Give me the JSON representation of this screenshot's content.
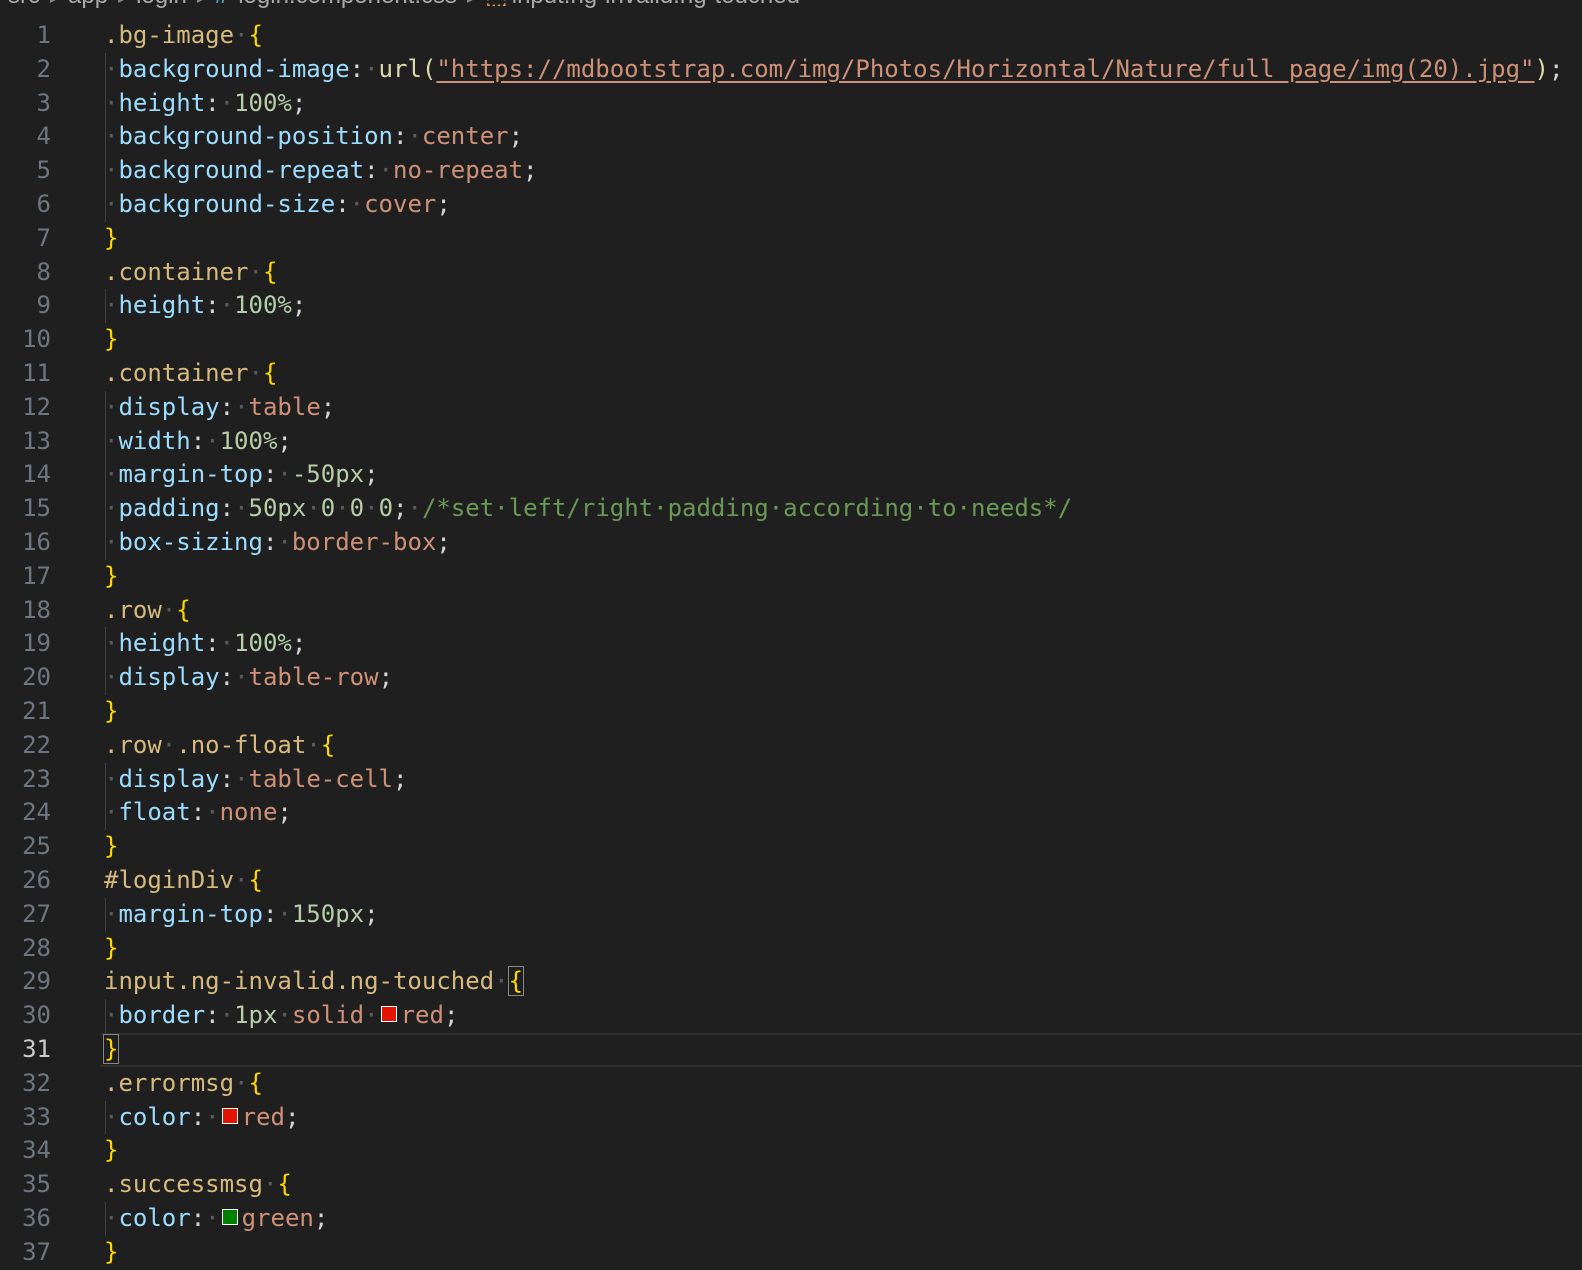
{
  "breadcrumb": {
    "items": [
      "src",
      "app",
      "login",
      "login.component.css",
      "input.ng-invalid.ng-touched"
    ],
    "css_icon": "#",
    "symbol_icon": "⬚"
  },
  "editor": {
    "active_line": 31,
    "colors": {
      "red": "#e51400",
      "green": "#008000"
    },
    "lines": [
      {
        "n": "1",
        "t": [
          {
            "c": "sel",
            "v": ".bg-image"
          },
          {
            "c": "ws",
            "v": "·"
          },
          {
            "c": "brace",
            "v": "{"
          }
        ]
      },
      {
        "n": "2",
        "g": true,
        "t": [
          {
            "c": "ws",
            "v": "·"
          },
          {
            "c": "prop",
            "v": "background-image"
          },
          {
            "c": "punc",
            "v": ":"
          },
          {
            "c": "ws",
            "v": "·"
          },
          {
            "c": "fn",
            "v": "url("
          },
          {
            "c": "str",
            "v": "\"https://mdbootstrap.com/img/Photos/Horizontal/Nature/full page/img(20).jpg\""
          },
          {
            "c": "fn",
            "v": ")"
          },
          {
            "c": "punc",
            "v": ";"
          }
        ]
      },
      {
        "n": "3",
        "g": true,
        "t": [
          {
            "c": "ws",
            "v": "·"
          },
          {
            "c": "prop",
            "v": "height"
          },
          {
            "c": "punc",
            "v": ":"
          },
          {
            "c": "ws",
            "v": "·"
          },
          {
            "c": "num",
            "v": "100%"
          },
          {
            "c": "punc",
            "v": ";"
          }
        ]
      },
      {
        "n": "4",
        "g": true,
        "t": [
          {
            "c": "ws",
            "v": "·"
          },
          {
            "c": "prop",
            "v": "background-position"
          },
          {
            "c": "punc",
            "v": ":"
          },
          {
            "c": "ws",
            "v": "·"
          },
          {
            "c": "val",
            "v": "center"
          },
          {
            "c": "punc",
            "v": ";"
          }
        ]
      },
      {
        "n": "5",
        "g": true,
        "t": [
          {
            "c": "ws",
            "v": "·"
          },
          {
            "c": "prop",
            "v": "background-repeat"
          },
          {
            "c": "punc",
            "v": ":"
          },
          {
            "c": "ws",
            "v": "·"
          },
          {
            "c": "val",
            "v": "no-repeat"
          },
          {
            "c": "punc",
            "v": ";"
          }
        ]
      },
      {
        "n": "6",
        "g": true,
        "t": [
          {
            "c": "ws",
            "v": "·"
          },
          {
            "c": "prop",
            "v": "background-size"
          },
          {
            "c": "punc",
            "v": ":"
          },
          {
            "c": "ws",
            "v": "·"
          },
          {
            "c": "val",
            "v": "cover"
          },
          {
            "c": "punc",
            "v": ";"
          }
        ]
      },
      {
        "n": "7",
        "t": [
          {
            "c": "brace",
            "v": "}"
          }
        ]
      },
      {
        "n": "8",
        "t": [
          {
            "c": "sel",
            "v": ".container"
          },
          {
            "c": "ws",
            "v": "·"
          },
          {
            "c": "brace",
            "v": "{"
          }
        ]
      },
      {
        "n": "9",
        "g": true,
        "t": [
          {
            "c": "ws",
            "v": "·"
          },
          {
            "c": "prop",
            "v": "height"
          },
          {
            "c": "punc",
            "v": ":"
          },
          {
            "c": "ws",
            "v": "·"
          },
          {
            "c": "num",
            "v": "100%"
          },
          {
            "c": "punc",
            "v": ";"
          }
        ]
      },
      {
        "n": "10",
        "t": [
          {
            "c": "brace",
            "v": "}"
          }
        ]
      },
      {
        "n": "11",
        "t": [
          {
            "c": "sel",
            "v": ".container"
          },
          {
            "c": "ws",
            "v": "·"
          },
          {
            "c": "brace",
            "v": "{"
          }
        ]
      },
      {
        "n": "12",
        "g": true,
        "t": [
          {
            "c": "ws",
            "v": "·"
          },
          {
            "c": "prop",
            "v": "display"
          },
          {
            "c": "punc",
            "v": ":"
          },
          {
            "c": "ws",
            "v": "·"
          },
          {
            "c": "val",
            "v": "table"
          },
          {
            "c": "punc",
            "v": ";"
          }
        ]
      },
      {
        "n": "13",
        "g": true,
        "t": [
          {
            "c": "ws",
            "v": "·"
          },
          {
            "c": "prop",
            "v": "width"
          },
          {
            "c": "punc",
            "v": ":"
          },
          {
            "c": "ws",
            "v": "·"
          },
          {
            "c": "num",
            "v": "100%"
          },
          {
            "c": "punc",
            "v": ";"
          }
        ]
      },
      {
        "n": "14",
        "g": true,
        "t": [
          {
            "c": "ws",
            "v": "·"
          },
          {
            "c": "prop",
            "v": "margin-top"
          },
          {
            "c": "punc",
            "v": ":"
          },
          {
            "c": "ws",
            "v": "·"
          },
          {
            "c": "num",
            "v": "-50px"
          },
          {
            "c": "punc",
            "v": ";"
          }
        ]
      },
      {
        "n": "15",
        "g": true,
        "t": [
          {
            "c": "ws",
            "v": "·"
          },
          {
            "c": "prop",
            "v": "padding"
          },
          {
            "c": "punc",
            "v": ":"
          },
          {
            "c": "ws",
            "v": "·"
          },
          {
            "c": "num",
            "v": "50px"
          },
          {
            "c": "ws",
            "v": "·"
          },
          {
            "c": "num",
            "v": "0"
          },
          {
            "c": "ws",
            "v": "·"
          },
          {
            "c": "num",
            "v": "0"
          },
          {
            "c": "ws",
            "v": "·"
          },
          {
            "c": "num",
            "v": "0"
          },
          {
            "c": "punc",
            "v": ";"
          },
          {
            "c": "ws",
            "v": "·"
          },
          {
            "c": "cmt",
            "v": "/*set·left/right·padding·according·to·needs*/"
          }
        ]
      },
      {
        "n": "16",
        "g": true,
        "t": [
          {
            "c": "ws",
            "v": "·"
          },
          {
            "c": "prop",
            "v": "box-sizing"
          },
          {
            "c": "punc",
            "v": ":"
          },
          {
            "c": "ws",
            "v": "·"
          },
          {
            "c": "val",
            "v": "border-box"
          },
          {
            "c": "punc",
            "v": ";"
          }
        ]
      },
      {
        "n": "17",
        "t": [
          {
            "c": "brace",
            "v": "}"
          }
        ]
      },
      {
        "n": "18",
        "t": [
          {
            "c": "sel",
            "v": ".row"
          },
          {
            "c": "ws",
            "v": "·"
          },
          {
            "c": "brace",
            "v": "{"
          }
        ]
      },
      {
        "n": "19",
        "g": true,
        "t": [
          {
            "c": "ws",
            "v": "·"
          },
          {
            "c": "prop",
            "v": "height"
          },
          {
            "c": "punc",
            "v": ":"
          },
          {
            "c": "ws",
            "v": "·"
          },
          {
            "c": "num",
            "v": "100%"
          },
          {
            "c": "punc",
            "v": ";"
          }
        ]
      },
      {
        "n": "20",
        "g": true,
        "t": [
          {
            "c": "ws",
            "v": "·"
          },
          {
            "c": "prop",
            "v": "display"
          },
          {
            "c": "punc",
            "v": ":"
          },
          {
            "c": "ws",
            "v": "·"
          },
          {
            "c": "val",
            "v": "table-row"
          },
          {
            "c": "punc",
            "v": ";"
          }
        ]
      },
      {
        "n": "21",
        "t": [
          {
            "c": "brace",
            "v": "}"
          }
        ]
      },
      {
        "n": "22",
        "t": [
          {
            "c": "sel",
            "v": ".row"
          },
          {
            "c": "ws",
            "v": "·"
          },
          {
            "c": "sel",
            "v": ".no-float"
          },
          {
            "c": "ws",
            "v": "·"
          },
          {
            "c": "brace",
            "v": "{"
          }
        ]
      },
      {
        "n": "23",
        "g": true,
        "t": [
          {
            "c": "ws",
            "v": "·"
          },
          {
            "c": "prop",
            "v": "display"
          },
          {
            "c": "punc",
            "v": ":"
          },
          {
            "c": "ws",
            "v": "·"
          },
          {
            "c": "val",
            "v": "table-cell"
          },
          {
            "c": "punc",
            "v": ";"
          }
        ]
      },
      {
        "n": "24",
        "g": true,
        "t": [
          {
            "c": "ws",
            "v": "·"
          },
          {
            "c": "prop",
            "v": "float"
          },
          {
            "c": "punc",
            "v": ":"
          },
          {
            "c": "ws",
            "v": "·"
          },
          {
            "c": "val",
            "v": "none"
          },
          {
            "c": "punc",
            "v": ";"
          }
        ]
      },
      {
        "n": "25",
        "t": [
          {
            "c": "brace",
            "v": "}"
          }
        ]
      },
      {
        "n": "26",
        "t": [
          {
            "c": "sel",
            "v": "#loginDiv"
          },
          {
            "c": "ws",
            "v": "·"
          },
          {
            "c": "brace",
            "v": "{"
          }
        ]
      },
      {
        "n": "27",
        "g": true,
        "t": [
          {
            "c": "ws",
            "v": "·"
          },
          {
            "c": "prop",
            "v": "margin-top"
          },
          {
            "c": "punc",
            "v": ":"
          },
          {
            "c": "ws",
            "v": "·"
          },
          {
            "c": "num",
            "v": "150px"
          },
          {
            "c": "punc",
            "v": ";"
          }
        ]
      },
      {
        "n": "28",
        "t": [
          {
            "c": "brace",
            "v": "}"
          }
        ]
      },
      {
        "n": "29",
        "t": [
          {
            "c": "sel",
            "v": "input.ng-invalid.ng-touched"
          },
          {
            "c": "ws",
            "v": "·"
          },
          {
            "c": "brace match",
            "v": "{"
          }
        ]
      },
      {
        "n": "30",
        "g": true,
        "t": [
          {
            "c": "ws",
            "v": "·"
          },
          {
            "c": "prop",
            "v": "border"
          },
          {
            "c": "punc",
            "v": ":"
          },
          {
            "c": "ws",
            "v": "·"
          },
          {
            "c": "num",
            "v": "1px"
          },
          {
            "c": "ws",
            "v": "·"
          },
          {
            "c": "val",
            "v": "solid"
          },
          {
            "c": "ws",
            "v": "·"
          },
          {
            "c": "swatch",
            "v": "red"
          },
          {
            "c": "val",
            "v": "red"
          },
          {
            "c": "punc",
            "v": ";"
          }
        ]
      },
      {
        "n": "31",
        "t": [
          {
            "c": "brace match",
            "v": "}"
          }
        ]
      },
      {
        "n": "32",
        "t": [
          {
            "c": "sel",
            "v": ".errormsg"
          },
          {
            "c": "ws",
            "v": "·"
          },
          {
            "c": "brace",
            "v": "{"
          }
        ]
      },
      {
        "n": "33",
        "g": true,
        "t": [
          {
            "c": "ws",
            "v": "·"
          },
          {
            "c": "prop",
            "v": "color"
          },
          {
            "c": "punc",
            "v": ":"
          },
          {
            "c": "ws",
            "v": "·"
          },
          {
            "c": "swatch",
            "v": "red"
          },
          {
            "c": "val",
            "v": "red"
          },
          {
            "c": "punc",
            "v": ";"
          }
        ]
      },
      {
        "n": "34",
        "t": [
          {
            "c": "brace",
            "v": "}"
          }
        ]
      },
      {
        "n": "35",
        "t": [
          {
            "c": "sel",
            "v": ".successmsg"
          },
          {
            "c": "ws",
            "v": "·"
          },
          {
            "c": "brace",
            "v": "{"
          }
        ]
      },
      {
        "n": "36",
        "g": true,
        "t": [
          {
            "c": "ws",
            "v": "·"
          },
          {
            "c": "prop",
            "v": "color"
          },
          {
            "c": "punc",
            "v": ":"
          },
          {
            "c": "ws",
            "v": "·"
          },
          {
            "c": "swatch",
            "v": "green"
          },
          {
            "c": "val",
            "v": "green"
          },
          {
            "c": "punc",
            "v": ";"
          }
        ]
      },
      {
        "n": "37",
        "t": [
          {
            "c": "brace",
            "v": "}"
          }
        ]
      }
    ]
  }
}
